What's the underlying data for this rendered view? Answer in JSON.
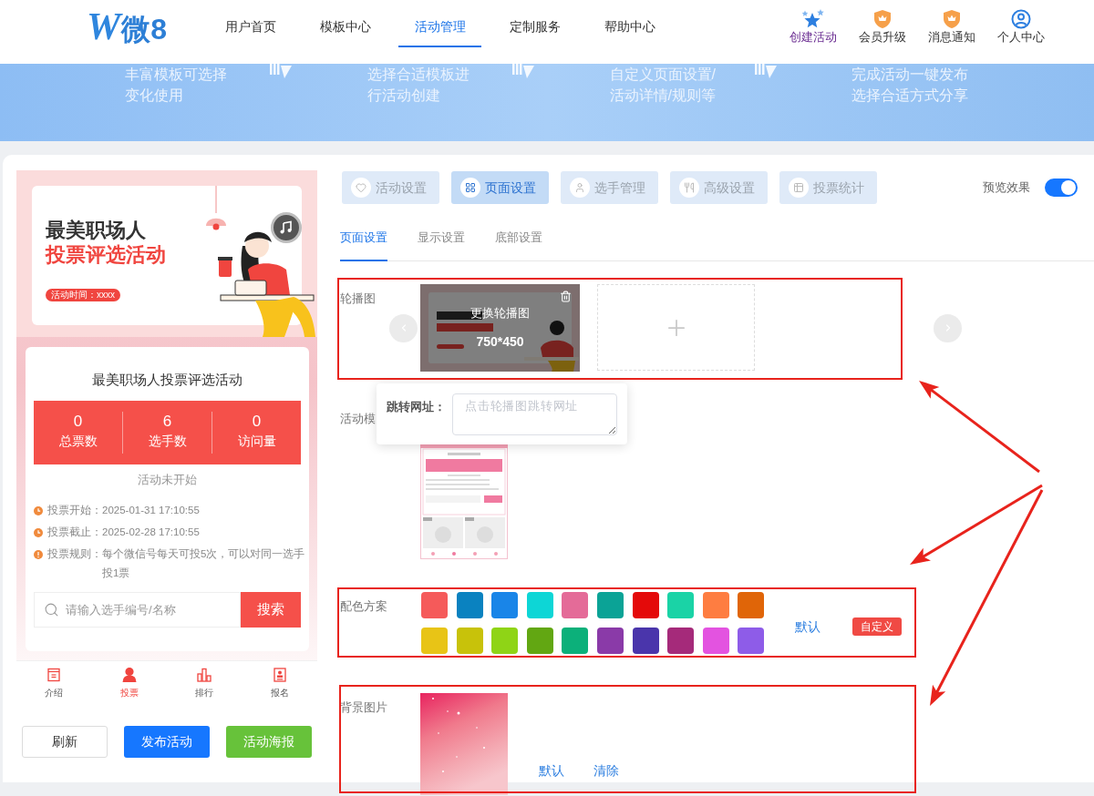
{
  "header": {
    "logo": {
      "mark": "W",
      "name": "微8"
    },
    "nav": [
      {
        "label": "用户首页",
        "selected": false
      },
      {
        "label": "模板中心",
        "selected": false
      },
      {
        "label": "活动管理",
        "selected": true
      },
      {
        "label": "定制服务",
        "selected": false
      },
      {
        "label": "帮助中心",
        "selected": false
      }
    ],
    "actions": [
      {
        "kind": "create",
        "label": "创建活动"
      },
      {
        "kind": "badge",
        "label": "会员升级"
      },
      {
        "kind": "badge",
        "label": "消息通知"
      },
      {
        "kind": "account",
        "label": "个人中心"
      }
    ]
  },
  "banner_steps": [
    {
      "text": "丰富模板可选择变化使用"
    },
    {
      "text": "选择合适模板进行活动创建"
    },
    {
      "text": "自定义页面设置/活动详情/规则等"
    },
    {
      "text": "完成活动一键发布选择合适方式分享"
    }
  ],
  "preview": {
    "poster": {
      "title": "最美职场人",
      "subtitle": "投票评选活动",
      "tag": "活动时间：xxxx"
    },
    "activity_title": "最美职场人投票评选活动",
    "stats": [
      {
        "value": "0",
        "label": "总票数"
      },
      {
        "value": "6",
        "label": "选手数"
      },
      {
        "value": "0",
        "label": "访问量"
      }
    ],
    "status": "活动未开始",
    "info": [
      {
        "kind": "time",
        "label": "投票开始：",
        "value": "2025-01-31 17:10:55"
      },
      {
        "kind": "time",
        "label": "投票截止：",
        "value": "2025-02-28 17:10:55"
      },
      {
        "kind": "rule",
        "label": "投票规则：",
        "value": "每个微信号每天可投5次，可以对同一选手投1票"
      }
    ],
    "search": {
      "placeholder": "请输入选手编号/名称",
      "button": "搜索"
    },
    "tabbar": [
      {
        "label": "介绍",
        "selected": false
      },
      {
        "label": "投票",
        "selected": true
      },
      {
        "label": "排行",
        "selected": false
      },
      {
        "label": "报名",
        "selected": false
      }
    ]
  },
  "preview_buttons": [
    {
      "kind": "outline",
      "label": "刷新"
    },
    {
      "kind": "primary",
      "label": "发布活动"
    },
    {
      "kind": "success",
      "label": "活动海报"
    }
  ],
  "settings": {
    "tabs": [
      {
        "label": "活动设置",
        "selected": false
      },
      {
        "label": "页面设置",
        "selected": true
      },
      {
        "label": "选手管理",
        "selected": false
      },
      {
        "label": "高级设置",
        "selected": false
      },
      {
        "label": "投票统计",
        "selected": false
      }
    ],
    "preview_toggle": {
      "label": "预览效果",
      "on": true
    },
    "subtabs": [
      {
        "label": "页面设置",
        "selected": true
      },
      {
        "label": "显示设置",
        "selected": false
      },
      {
        "label": "底部设置",
        "selected": false
      }
    ],
    "carousel": {
      "label": "轮播图",
      "highlighted": true,
      "overlay_text": "更换轮播图",
      "size": "750*450",
      "link_popover": {
        "label": "跳转网址：",
        "placeholder": "点击轮播图跳转网址"
      }
    },
    "template": {
      "label": "活动模"
    },
    "color_scheme": {
      "label": "配色方案",
      "highlighted": true,
      "swatches": [
        {
          "color": "#f55a5a"
        },
        {
          "color": "#0a82c0"
        },
        {
          "color": "#1985e8"
        },
        {
          "color": "#0dd6d6"
        },
        {
          "color": "#e46b98"
        },
        {
          "color": "#0ba396"
        },
        {
          "color": "#e40a0a"
        },
        {
          "color": "#1ad3a6"
        },
        {
          "color": "#fe7d41"
        },
        {
          "color": "#e06508"
        },
        {
          "color": "#e8c416"
        },
        {
          "color": "#c8c20a"
        },
        {
          "color": "#8fd416"
        },
        {
          "color": "#62a712"
        },
        {
          "color": "#0cb07a"
        },
        {
          "color": "#8a3aa8"
        },
        {
          "color": "#4a35ab"
        },
        {
          "color": "#a52a7a"
        },
        {
          "color": "#e353e0"
        },
        {
          "color": "#8e5ce8"
        }
      ],
      "default_link": "默认",
      "custom_button": "自定义"
    },
    "background": {
      "label": "背景图片",
      "highlighted": true,
      "default_link": "默认",
      "clear_link": "清除"
    }
  }
}
